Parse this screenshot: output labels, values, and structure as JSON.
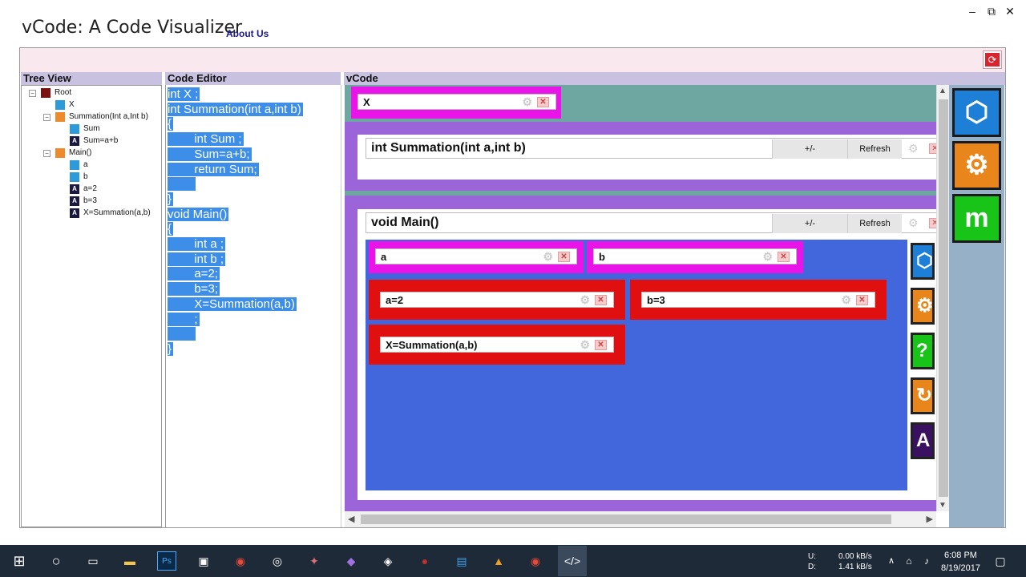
{
  "window": {
    "title": "vCode: A Code Visualizer",
    "about_link": "About Us",
    "minimize": "–",
    "restore": "⧉",
    "close": "✕"
  },
  "panels": {
    "tree_view": "Tree View",
    "code_editor": "Code Editor",
    "vcode": "vCode"
  },
  "tree": [
    {
      "label": "Root",
      "icon": "root-icon",
      "depth": 0,
      "expander": "−"
    },
    {
      "label": "X",
      "icon": "variable-icon",
      "depth": 1,
      "expander": ""
    },
    {
      "label": "Summation(Int a,Int b)",
      "icon": "function-icon",
      "depth": 1,
      "expander": "−"
    },
    {
      "label": "Sum",
      "icon": "variable-icon",
      "depth": 2,
      "expander": ""
    },
    {
      "label": "Sum=a+b",
      "icon": "assignment-icon",
      "depth": 2,
      "expander": ""
    },
    {
      "label": "Main()",
      "icon": "function-icon",
      "depth": 1,
      "expander": "−"
    },
    {
      "label": "a",
      "icon": "variable-icon",
      "depth": 2,
      "expander": ""
    },
    {
      "label": "b",
      "icon": "variable-icon",
      "depth": 2,
      "expander": ""
    },
    {
      "label": "a=2",
      "icon": "assignment-icon",
      "depth": 2,
      "expander": ""
    },
    {
      "label": "b=3",
      "icon": "assignment-icon",
      "depth": 2,
      "expander": ""
    },
    {
      "label": "X=Summation(a,b)",
      "icon": "assignment-icon",
      "depth": 2,
      "expander": ""
    }
  ],
  "code": [
    "int X ;",
    "int Summation(int a,int b)",
    "{",
    "        int Sum ;",
    "        Sum=a+b;",
    "        return Sum;",
    "        ",
    "}",
    "void Main()",
    "{",
    "        int a ;",
    "        int b ;",
    "        a=2;",
    "        b=3;",
    "        X=Summation(a,b)",
    "        ;",
    "        ",
    "}"
  ],
  "vcode": {
    "global_var": "X",
    "summation": {
      "title": "int Summation(int a,int b)",
      "plusminus": "+/-",
      "refresh": "Refresh"
    },
    "main": {
      "title": "void Main()",
      "plusminus": "+/-",
      "refresh": "Refresh",
      "vars": [
        "a",
        "b"
      ],
      "assigns": [
        "a=2",
        "b=3"
      ],
      "call": "X=Summation(a,b)"
    }
  },
  "side_icons": [
    {
      "name": "box-icon",
      "color": "#1e7fd6"
    },
    {
      "name": "gears-icon",
      "color": "#e8861c"
    },
    {
      "name": "m-icon",
      "color": "#19c419",
      "glyph": "m"
    }
  ],
  "mini_icons": [
    {
      "name": "box-icon",
      "color": "#1e7fd6"
    },
    {
      "name": "gear-icon",
      "color": "#e8861c"
    },
    {
      "name": "help-icon",
      "color": "#19c419"
    },
    {
      "name": "cycle-icon",
      "color": "#e8861c"
    },
    {
      "name": "text-icon",
      "color": "#3a1060",
      "glyph": "A"
    }
  ],
  "taskbar": {
    "net_up_label": "U:",
    "net_down_label": "D:",
    "net_up": "0.00 kB/s",
    "net_down": "1.41 kB/s",
    "time": "6:08 PM",
    "date": "8/19/2017"
  },
  "colors": {
    "purple": "#9b64d8",
    "teal": "#6ea6a2",
    "magenta": "#e814e8",
    "red": "#e01010",
    "blue": "#4266db",
    "code_highlight": "#3d8ee8"
  }
}
